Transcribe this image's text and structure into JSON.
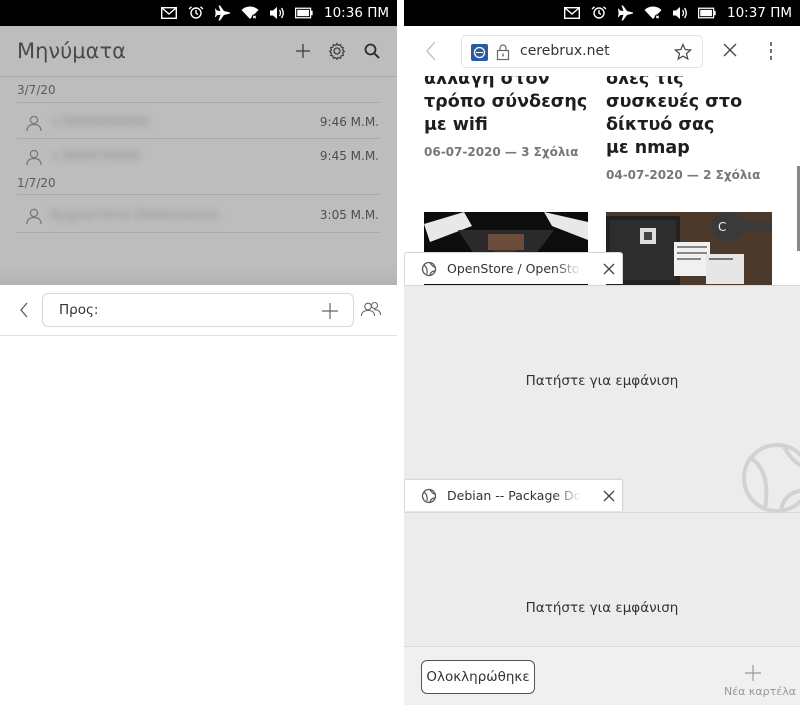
{
  "left_status": {
    "time": "10:36 ΠΜ",
    "icons": [
      "envelope-icon",
      "alarm-icon",
      "airplane-icon",
      "wifi-icon",
      "volume-icon",
      "battery-icon"
    ]
  },
  "right_status": {
    "time": "10:37 ΠΜ",
    "icons": [
      "envelope-icon",
      "alarm-icon",
      "airplane-icon",
      "wifi-icon",
      "volume-icon",
      "battery-icon"
    ]
  },
  "messages": {
    "title": "Μηνύματα",
    "groups": [
      {
        "date": "3/7/20",
        "items": [
          {
            "name": "+3069000000",
            "time": "9:46 Μ.Μ."
          },
          {
            "name": "+306976000",
            "time": "9:45 Μ.Μ."
          }
        ]
      },
      {
        "date": "1/7/20",
        "items": [
          {
            "name": "Sygxaritiria Dedomenon",
            "time": "3:05 Μ.Μ."
          }
        ]
      }
    ],
    "compose_to_label": "Προς:"
  },
  "browser": {
    "url": "cerebrux.net",
    "articles": [
      {
        "title_lines": [
          "αλλαγή στον",
          "τρόπο σύνδεσης",
          "με wifi"
        ],
        "meta": "06-07-2020 — 3 Σχόλια"
      },
      {
        "title_lines": [
          "όλες τις",
          "συσκευές στο",
          "δίκτυό σας",
          "με nmap"
        ],
        "meta": "04-07-2020 — 2 Σχόλια"
      }
    ],
    "tabs": [
      {
        "title": "OpenStore / OpenStore",
        "placeholder": "Πατήστε για εμφάνιση"
      },
      {
        "title": "Debian -- Package Download",
        "placeholder": "Πατήστε για εμφάνιση"
      }
    ],
    "done_label": "Ολοκληρώθηκε",
    "new_tab_label": "Νέα καρτέλα"
  },
  "colors": {
    "status_bar": "#000000",
    "messages_dim_bg": "#bdbdbd",
    "tab_area_bg": "#ececec",
    "favicon": "#2b5aa0"
  }
}
